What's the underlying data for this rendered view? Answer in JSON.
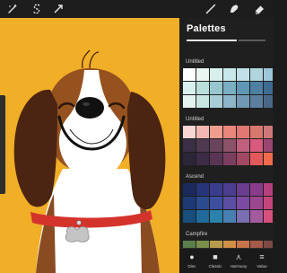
{
  "toolbar": {
    "left_icons": [
      "adjustments-wand-icon",
      "selection-s-icon",
      "transform-arrow-icon"
    ],
    "right_icons": [
      "brush-icon",
      "smudge-icon",
      "eraser-icon"
    ]
  },
  "panel": {
    "title": "Palettes",
    "palettes": [
      {
        "name": "Untitled",
        "swatches": [
          "#ffffff",
          "#e9f6f1",
          "#d7f0ec",
          "#c8e7ea",
          "#bfe0e6",
          "#afd4de",
          "#9dc7d8",
          "#d9f1ee",
          "#b8dfda",
          "#97c6cf",
          "#7aaec2",
          "#5f97b5",
          "#4d80a3",
          "#3e6b91",
          "#e5f3f0",
          "#c7e6e2",
          "#a7ced5",
          "#8db6c8",
          "#7199b3",
          "#5d7f9f",
          "#4a6787"
        ]
      },
      {
        "name": "Untitled",
        "swatches": [
          "#f7d6d4",
          "#f2b7b1",
          "#ef9d8d",
          "#e9877c",
          "#e07871",
          "#d7786f",
          "#cf7778",
          "#3b2f45",
          "#4e3950",
          "#6a445c",
          "#8c5267",
          "#c0607c",
          "#d85a7e",
          "#9a4572",
          "#2b2538",
          "#3c2c48",
          "#5a3454",
          "#7b3e5e",
          "#a34862",
          "#e45a5a",
          "#f06a4e"
        ]
      },
      {
        "name": "Ascend",
        "swatches": [
          "#1a2a5c",
          "#26357a",
          "#3a3c8e",
          "#4c3d8f",
          "#6a3d8f",
          "#8a3c8c",
          "#b5407d",
          "#1d3a74",
          "#2c4a8e",
          "#3e4fa0",
          "#5b4ea4",
          "#7c4aa2",
          "#9d4690",
          "#c5447a",
          "#174e7c",
          "#1f6a9a",
          "#2b82ad",
          "#4a7fb3",
          "#7a6fb0",
          "#a55a9f",
          "#d6507f"
        ]
      },
      {
        "name": "Campfire",
        "swatches": [
          "#5a7f4a",
          "#7a8f4c",
          "#b89a4c",
          "#d08f48",
          "#c9744a",
          "#a85a48",
          "#7e4a46"
        ]
      }
    ]
  },
  "bottom_tabs": [
    {
      "label": "Disc",
      "icon": "disc-icon"
    },
    {
      "label": "Classic",
      "icon": "classic-icon"
    },
    {
      "label": "Harmony",
      "icon": "harmony-icon"
    },
    {
      "label": "Value",
      "icon": "value-icon"
    }
  ]
}
